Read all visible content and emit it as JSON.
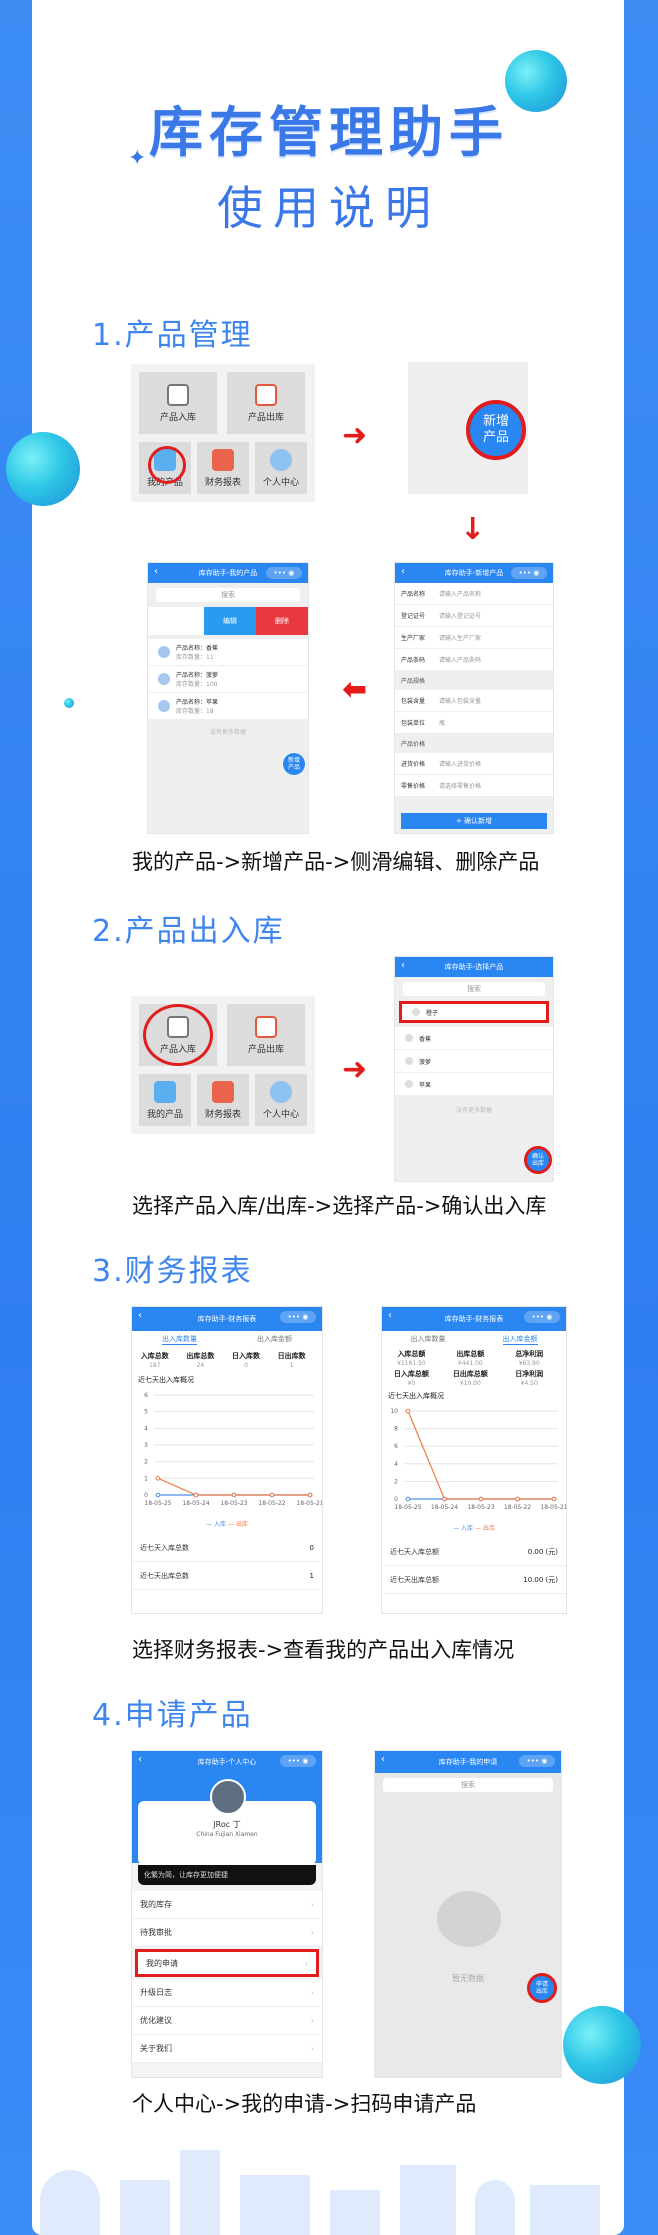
{
  "colors": {
    "accent": "#3a78e8",
    "red": "#e51b1b",
    "app_blue": "#2a86f0"
  },
  "header": {
    "title": "库存管理助手",
    "subtitle": "使用说明"
  },
  "sections": [
    {
      "heading": "1.产品管理",
      "caption": "我的产品->新增产品->侧滑编辑、删除产品"
    },
    {
      "heading": "2.产品出入库",
      "caption": "选择产品入库/出库->选择产品->确认出入库"
    },
    {
      "heading": "3.财务报表",
      "caption": "选择财务报表->查看我的产品出入库情况"
    },
    {
      "heading": "4.申请产品",
      "caption": "个人中心->我的申请->扫码申请产品"
    }
  ],
  "home_grid": {
    "items": [
      {
        "label": "产品入库",
        "icon": "warehouse-in-icon"
      },
      {
        "label": "产品出库",
        "icon": "warehouse-out-icon"
      },
      {
        "label": "我的产品",
        "icon": "product-icon"
      },
      {
        "label": "财务报表",
        "icon": "report-icon"
      },
      {
        "label": "个人中心",
        "icon": "user-icon"
      }
    ]
  },
  "new_product_button": {
    "label_1": "新增",
    "label_2": "产品"
  },
  "my_products_screen": {
    "title": "库存助手-我的产品",
    "search": "搜索",
    "edit": "编辑",
    "delete": "删除",
    "items": [
      {
        "name": "产品名称：香蕉",
        "stock": "库存数量：11"
      },
      {
        "name": "产品名称：菠萝",
        "stock": "库存数量：100"
      },
      {
        "name": "产品名称：苹果",
        "stock": "库存数量：18"
      }
    ],
    "empty": "没有更多数据",
    "fab_1": "新增",
    "fab_2": "产品"
  },
  "new_product_form": {
    "title": "库存助手-新增产品",
    "rows": [
      {
        "k": "产品名称",
        "v": "请输入产品名称"
      },
      {
        "k": "登记证号",
        "v": "请输入登记证号"
      },
      {
        "k": "生产厂家",
        "v": "请输入生产厂家"
      },
      {
        "k": "产品条码",
        "v": "请输入产品条码"
      }
    ],
    "spec_section": "产品规格",
    "spec_rows": [
      {
        "k": "包装含量",
        "v": "请输入包装含量"
      },
      {
        "k": "包装单位",
        "v": "瓶"
      }
    ],
    "price_section": "产品价格",
    "price_rows": [
      {
        "k": "进货价格",
        "v": "请输入进货价格"
      },
      {
        "k": "零售价格",
        "v": "请选择零售价格"
      }
    ],
    "confirm": "+ 确认新增"
  },
  "select_product_screen": {
    "title": "库存助手-选择产品",
    "search": "搜索",
    "items": [
      "橙子",
      "香蕉",
      "菠萝",
      "苹果"
    ],
    "empty": "没有更多数据",
    "fab_1": "确认",
    "fab_2": "出库"
  },
  "report_left": {
    "title": "库存助手-财务报表",
    "tab_1": "出入库数量",
    "tab_2": "出入库金额",
    "stats": [
      {
        "k": "入库总数",
        "v": "187"
      },
      {
        "k": "出库总数",
        "v": "24"
      },
      {
        "k": "日入库数",
        "v": "0"
      },
      {
        "k": "日出库数",
        "v": "1"
      }
    ],
    "chart_title": "近七天出入库概况",
    "legend_in": "入库",
    "legend_out": "出库",
    "rows": [
      {
        "k": "近七天入库总数",
        "v": "0"
      },
      {
        "k": "近七天出库总数",
        "v": "1"
      }
    ]
  },
  "report_right": {
    "title": "库存助手-财务报表",
    "tab_1": "出入库数量",
    "tab_2": "出入库金额",
    "stats": [
      {
        "k": "入库总额",
        "v": "¥1181.50"
      },
      {
        "k": "出库总额",
        "v": "¥441.00"
      },
      {
        "k": "总净利润",
        "v": "¥63.90"
      },
      {
        "k": "日入库总额",
        "v": "¥0"
      },
      {
        "k": "日出库总额",
        "v": "¥10.00"
      },
      {
        "k": "日净利润",
        "v": "¥4.50"
      }
    ],
    "chart_title": "近七天出入库概况",
    "legend_in": "入库",
    "legend_out": "出库",
    "rows": [
      {
        "k": "近七天入库总额",
        "v": "0.00 (元)"
      },
      {
        "k": "近七天出库总额",
        "v": "10.00 (元)"
      }
    ]
  },
  "chart_data": [
    {
      "type": "line",
      "title": "近七天出入库概况",
      "categories": [
        "18-05-25",
        "18-05-24",
        "18-05-23",
        "18-05-22",
        "18-05-21"
      ],
      "ylim": [
        0,
        6
      ],
      "yticks": [
        "0",
        "1",
        "2",
        "3",
        "4",
        "5",
        "6"
      ],
      "series": [
        {
          "name": "入库",
          "values": [
            0,
            0,
            0,
            0,
            0
          ]
        },
        {
          "name": "出库",
          "values": [
            1,
            0,
            0,
            0,
            0
          ]
        }
      ]
    },
    {
      "type": "line",
      "title": "近七天出入库概况",
      "categories": [
        "18-05-25",
        "18-05-24",
        "18-05-23",
        "18-05-22",
        "18-05-21"
      ],
      "ylim": [
        0,
        10
      ],
      "yticks": [
        "0",
        "2",
        "4",
        "6",
        "8",
        "10"
      ],
      "series": [
        {
          "name": "入库",
          "values": [
            0,
            0,
            0,
            0,
            0
          ]
        },
        {
          "name": "出库",
          "values": [
            10,
            0,
            0,
            0,
            0
          ]
        }
      ]
    }
  ],
  "profile_screen": {
    "title": "库存助手-个人中心",
    "username": "JRoc 丁",
    "location": "China Fujian Xiamen",
    "slogan": "化繁为简，让库存更加便捷",
    "menu": [
      "我的库存",
      "待我审批",
      "我的申请",
      "升级日志",
      "优化建议",
      "关于我们"
    ]
  },
  "my_apply_screen": {
    "title": "库存助手-我的申请",
    "search": "搜索",
    "empty": "暂无数据",
    "fab_1": "申请",
    "fab_2": "出库"
  }
}
